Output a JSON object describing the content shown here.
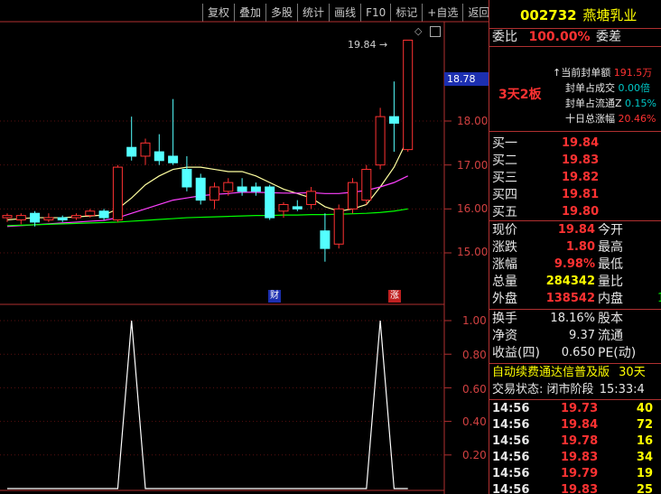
{
  "toolbar": [
    "复权",
    "叠加",
    "多股",
    "统计",
    "画线",
    "F10",
    "标记",
    "+自选",
    "返回"
  ],
  "stock": {
    "code": "002732",
    "name": "燕塘乳业"
  },
  "weibi": {
    "label": "委比",
    "value": "100.00%",
    "label2": "委差"
  },
  "seal": {
    "badge": "3天2板",
    "rows": [
      {
        "label": "当前封单额",
        "value": "191.5万"
      },
      {
        "label": "封单占成交",
        "value": "0.00倍"
      },
      {
        "label": "封单占流通Z",
        "value": "0.15%"
      },
      {
        "label": "十日总涨幅",
        "value": "20.46%"
      }
    ]
  },
  "buy_orders": [
    {
      "label": "买一",
      "price": "19.84"
    },
    {
      "label": "买二",
      "price": "19.83"
    },
    {
      "label": "买三",
      "price": "19.82"
    },
    {
      "label": "买四",
      "price": "19.81"
    },
    {
      "label": "买五",
      "price": "19.80"
    }
  ],
  "quote": [
    {
      "l": "现价",
      "v": "19.84",
      "l2": "今开",
      "v2": ""
    },
    {
      "l": "涨跌",
      "v": "1.80",
      "l2": "最高",
      "v2": ""
    },
    {
      "l": "涨幅",
      "v": "9.98%",
      "l2": "最低",
      "v2": ""
    },
    {
      "l": "总量",
      "v": "284342",
      "l2": "量比",
      "v2": ""
    },
    {
      "l": "外盘",
      "v": "138542",
      "l2": "内盘",
      "v2": "1"
    }
  ],
  "finance": [
    {
      "l": "换手",
      "v": "18.16%",
      "l2": "股本"
    },
    {
      "l": "净资",
      "v": "9.37",
      "l2": "流通"
    },
    {
      "l": "收益(四)",
      "v": "0.650",
      "l2": "PE(动)"
    }
  ],
  "ad": {
    "text": "自动续费通达信普及版",
    "extra": "30天"
  },
  "trade_status": {
    "label": "交易状态:",
    "value": "闭市阶段",
    "time": "15:33:4"
  },
  "ticks": [
    {
      "t": "14:56",
      "p": "19.73",
      "v": "40"
    },
    {
      "t": "14:56",
      "p": "19.84",
      "v": "72"
    },
    {
      "t": "14:56",
      "p": "19.78",
      "v": "16"
    },
    {
      "t": "14:56",
      "p": "19.83",
      "v": "34"
    },
    {
      "t": "14:56",
      "p": "19.79",
      "v": "19"
    },
    {
      "t": "14:56",
      "p": "19.83",
      "v": "25"
    }
  ],
  "chart_data": [
    {
      "type": "candlestick",
      "price_axis": [
        "18.00",
        "17.00",
        "16.00",
        "15.00"
      ],
      "current_price_tag": "18.78",
      "max_label": "19.84",
      "markers": [
        "财",
        "涨"
      ],
      "ylim": [
        14.6,
        19.9
      ],
      "candles": [
        {
          "o": 15.8,
          "h": 15.9,
          "l": 15.7,
          "c": 15.85
        },
        {
          "o": 15.75,
          "h": 15.9,
          "l": 15.65,
          "c": 15.85
        },
        {
          "o": 15.9,
          "h": 15.95,
          "l": 15.6,
          "c": 15.7
        },
        {
          "o": 15.75,
          "h": 15.9,
          "l": 15.7,
          "c": 15.8
        },
        {
          "o": 15.8,
          "h": 15.85,
          "l": 15.7,
          "c": 15.75
        },
        {
          "o": 15.8,
          "h": 15.9,
          "l": 15.75,
          "c": 15.85
        },
        {
          "o": 15.85,
          "h": 16.0,
          "l": 15.8,
          "c": 15.95
        },
        {
          "o": 15.95,
          "h": 16.0,
          "l": 15.75,
          "c": 15.8
        },
        {
          "o": 15.75,
          "h": 17.0,
          "l": 15.7,
          "c": 16.95
        },
        {
          "o": 17.4,
          "h": 18.1,
          "l": 17.1,
          "c": 17.2
        },
        {
          "o": 17.2,
          "h": 17.6,
          "l": 17.0,
          "c": 17.5
        },
        {
          "o": 17.3,
          "h": 17.7,
          "l": 17.0,
          "c": 17.1
        },
        {
          "o": 17.2,
          "h": 18.5,
          "l": 17.0,
          "c": 17.05
        },
        {
          "o": 16.9,
          "h": 17.2,
          "l": 16.4,
          "c": 16.5
        },
        {
          "o": 16.7,
          "h": 16.8,
          "l": 16.1,
          "c": 16.2
        },
        {
          "o": 16.2,
          "h": 16.6,
          "l": 16.0,
          "c": 16.5
        },
        {
          "o": 16.4,
          "h": 16.7,
          "l": 16.3,
          "c": 16.6
        },
        {
          "o": 16.5,
          "h": 16.7,
          "l": 16.3,
          "c": 16.4
        },
        {
          "o": 16.5,
          "h": 16.6,
          "l": 16.3,
          "c": 16.4
        },
        {
          "o": 16.5,
          "h": 16.55,
          "l": 15.75,
          "c": 15.8
        },
        {
          "o": 15.95,
          "h": 16.15,
          "l": 15.8,
          "c": 16.1
        },
        {
          "o": 16.05,
          "h": 16.2,
          "l": 15.95,
          "c": 16.0
        },
        {
          "o": 16.1,
          "h": 16.5,
          "l": 16.0,
          "c": 16.4
        },
        {
          "o": 15.5,
          "h": 15.9,
          "l": 14.8,
          "c": 15.1
        },
        {
          "o": 15.2,
          "h": 16.1,
          "l": 15.1,
          "c": 16.0
        },
        {
          "o": 16.0,
          "h": 16.7,
          "l": 15.9,
          "c": 16.6
        },
        {
          "o": 16.2,
          "h": 17.0,
          "l": 16.1,
          "c": 16.9
        },
        {
          "o": 17.0,
          "h": 18.3,
          "l": 16.9,
          "c": 18.1
        },
        {
          "o": 18.1,
          "h": 18.9,
          "l": 17.3,
          "c": 17.95
        },
        {
          "o": 17.35,
          "h": 19.84,
          "l": 17.3,
          "c": 19.84
        }
      ],
      "ma_series": [
        {
          "color": "#ffffa0",
          "values": [
            15.75,
            15.78,
            15.8,
            15.8,
            15.8,
            15.82,
            15.84,
            15.86,
            16.0,
            16.25,
            16.55,
            16.75,
            16.9,
            16.95,
            16.95,
            16.9,
            16.85,
            16.85,
            16.75,
            16.6,
            16.45,
            16.35,
            16.25,
            16.05,
            15.95,
            16.0,
            16.1,
            16.5,
            16.95,
            17.6
          ]
        },
        {
          "color": "#ff40ff",
          "values": [
            15.6,
            15.62,
            15.64,
            15.66,
            15.68,
            15.7,
            15.72,
            15.74,
            15.8,
            15.9,
            16.0,
            16.1,
            16.2,
            16.25,
            16.3,
            16.33,
            16.35,
            16.38,
            16.38,
            16.37,
            16.36,
            16.36,
            16.37,
            16.35,
            16.35,
            16.38,
            16.42,
            16.5,
            16.6,
            16.75
          ]
        },
        {
          "color": "#00ff00",
          "values": [
            15.62,
            15.63,
            15.64,
            15.65,
            15.66,
            15.67,
            15.68,
            15.69,
            15.7,
            15.72,
            15.74,
            15.76,
            15.78,
            15.8,
            15.81,
            15.82,
            15.83,
            15.84,
            15.85,
            15.85,
            15.86,
            15.86,
            15.87,
            15.87,
            15.88,
            15.89,
            15.9,
            15.92,
            15.95,
            16.0
          ]
        }
      ]
    },
    {
      "type": "line",
      "y_axis": [
        "1.00",
        "0.80",
        "0.60",
        "0.40",
        "0.20"
      ],
      "ylim": [
        0,
        1.05
      ],
      "spikes": [
        {
          "index": 9,
          "value": 1.0
        },
        {
          "index": 27,
          "value": 1.0
        }
      ]
    }
  ]
}
